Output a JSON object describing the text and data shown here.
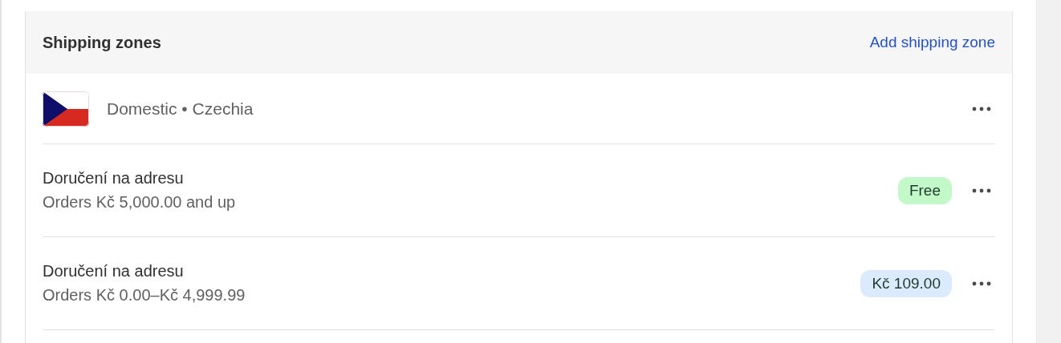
{
  "card": {
    "title": "Shipping zones",
    "action": "Add shipping zone",
    "zone": {
      "name": "Domestic • Czechia",
      "rates": [
        {
          "name": "Doručení na adresu",
          "condition": "Orders Kč 5,000.00 and up",
          "price": "Free",
          "color": "#c3f9c8"
        },
        {
          "name": "Doručení na adresu",
          "condition": "Orders Kč 0.00–Kč 4,999.99",
          "price": "Kč 109.00",
          "color": "#dbeafc"
        }
      ]
    }
  }
}
